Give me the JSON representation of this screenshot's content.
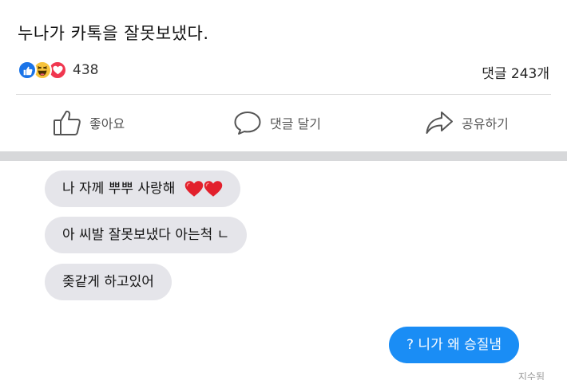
{
  "post": {
    "text": "누나가 카톡을 잘못보냈다.",
    "reactions": {
      "icons": [
        "like-icon",
        "haha-icon",
        "love-icon"
      ],
      "count": "438"
    },
    "comments": "댓글 243개",
    "actions": {
      "like": "좋아요",
      "comment": "댓글 달기",
      "share": "공유하기"
    }
  },
  "chat": {
    "messages": [
      {
        "direction": "incoming",
        "text": "나 자께 뿌뿌 사랑해",
        "emoji": [
          "red-heart-icon",
          "red-heart-icon"
        ]
      },
      {
        "direction": "incoming",
        "text": "아 씨발 잘못보냈다 아는척 ㄴ"
      },
      {
        "direction": "incoming",
        "text": "좆같게 하고있어"
      },
      {
        "direction": "outgoing",
        "text": "? 니가 왜 승질냄"
      }
    ],
    "receipt": "지수됨"
  },
  "colors": {
    "like": "#1a74e8",
    "haha": "#f7c33b",
    "love": "#f0374f",
    "outgoing_bubble": "#1a8df5",
    "incoming_bubble": "#e5e5ea",
    "separator": "#d7d8da"
  }
}
